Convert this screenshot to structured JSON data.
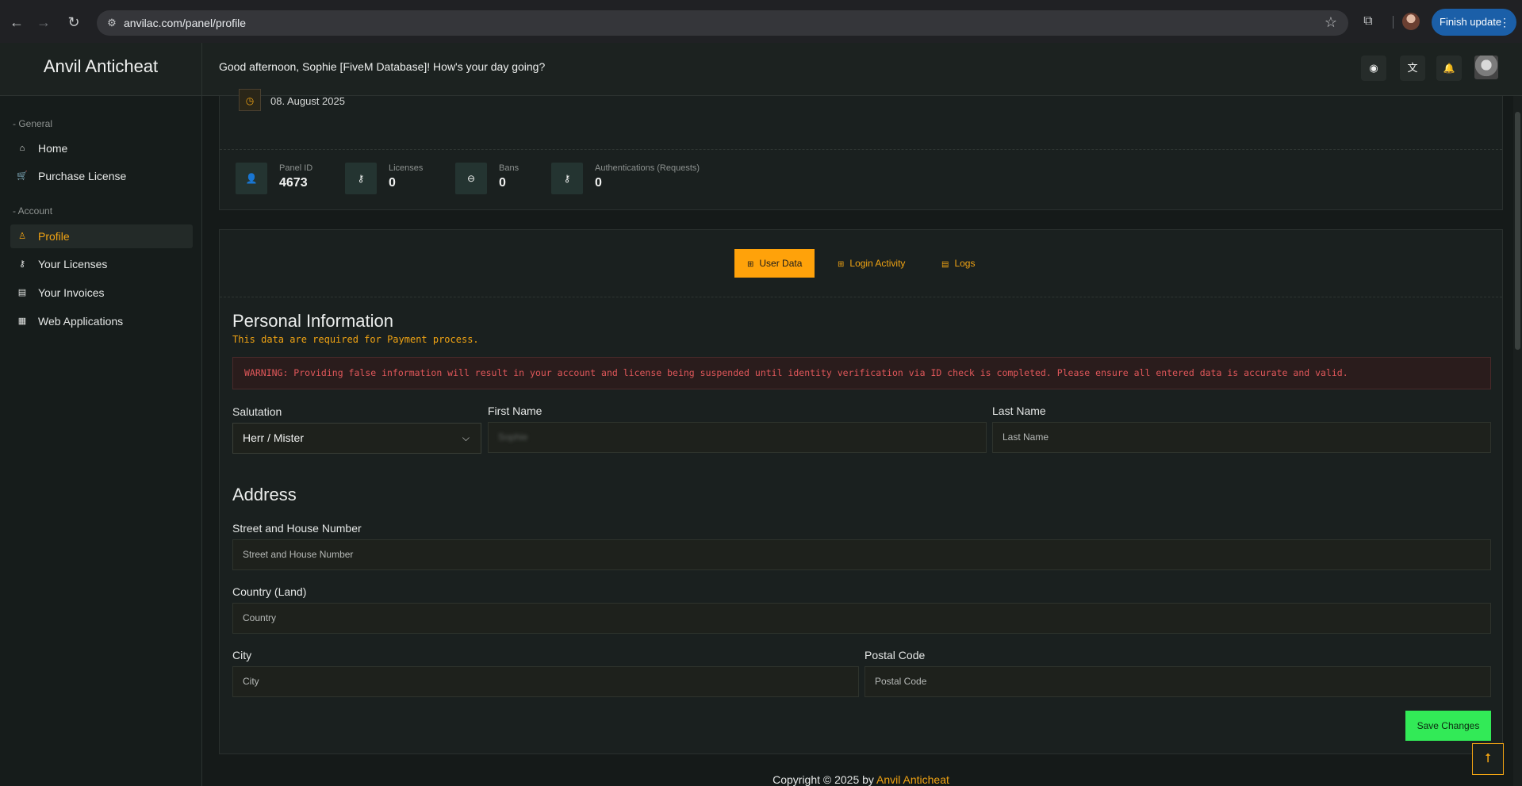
{
  "browser": {
    "url": "anvilac.com/panel/profile",
    "update_label": "Finish update",
    "icons": {
      "back": "←",
      "forward": "→",
      "reload": "↻",
      "tune": "⚙",
      "star": "☆",
      "extensions": "⧉",
      "menu": "⋮"
    }
  },
  "header": {
    "brand": "Anvil Anticheat",
    "greeting": "Good afternoon, Sophie [FiveM Database]! How's your day going?",
    "icons": {
      "discord": "◉",
      "translate": "文",
      "bell": "🔔"
    }
  },
  "sidebar": {
    "section_general": "- General",
    "section_account": "- Account",
    "items": [
      {
        "label": "Home",
        "icon": "⌂"
      },
      {
        "label": "Purchase License",
        "icon": "🛒"
      },
      {
        "label": "Profile",
        "icon": "♙"
      },
      {
        "label": "Your Licenses",
        "icon": "⚷"
      },
      {
        "label": "Your Invoices",
        "icon": "▤"
      },
      {
        "label": "Web Applications",
        "icon": "▦"
      }
    ]
  },
  "stats": {
    "date": "08. August 2025",
    "date_icon": "◷",
    "items": [
      {
        "label": "Panel ID",
        "value": "4673",
        "icon": "👤"
      },
      {
        "label": "Licenses",
        "value": "0",
        "icon": "⚷"
      },
      {
        "label": "Bans",
        "value": "0",
        "icon": "⊖"
      },
      {
        "label": "Authentications (Requests)",
        "value": "0",
        "icon": "⚷"
      }
    ]
  },
  "tabs": [
    {
      "label": "User Data",
      "icon": "⊞"
    },
    {
      "label": "Login Activity",
      "icon": "⊞"
    },
    {
      "label": "Logs",
      "icon": "▤"
    }
  ],
  "personal": {
    "title": "Personal Information",
    "subtitle": "This data are required for Payment process.",
    "warning": "WARNING: Providing false information will result in your account and license being suspended until identity verification via ID check is completed. Please ensure all entered data is accurate and valid.",
    "salutation_label": "Salutation",
    "salutation_value": "Herr / Mister",
    "first_name_label": "First Name",
    "first_name_value": "Sophie",
    "last_name_label": "Last Name",
    "last_name_placeholder": "Last Name"
  },
  "address": {
    "title": "Address",
    "street_label": "Street and House Number",
    "street_placeholder": "Street and House Number",
    "country_label": "Country (Land)",
    "country_placeholder": "Country",
    "city_label": "City",
    "city_placeholder": "City",
    "postal_label": "Postal Code",
    "postal_placeholder": "Postal Code"
  },
  "save_label": "Save Changes",
  "footer": {
    "text": "Copyright © 2025 by ",
    "link": "Anvil Anticheat"
  },
  "to_top_icon": "⭡"
}
